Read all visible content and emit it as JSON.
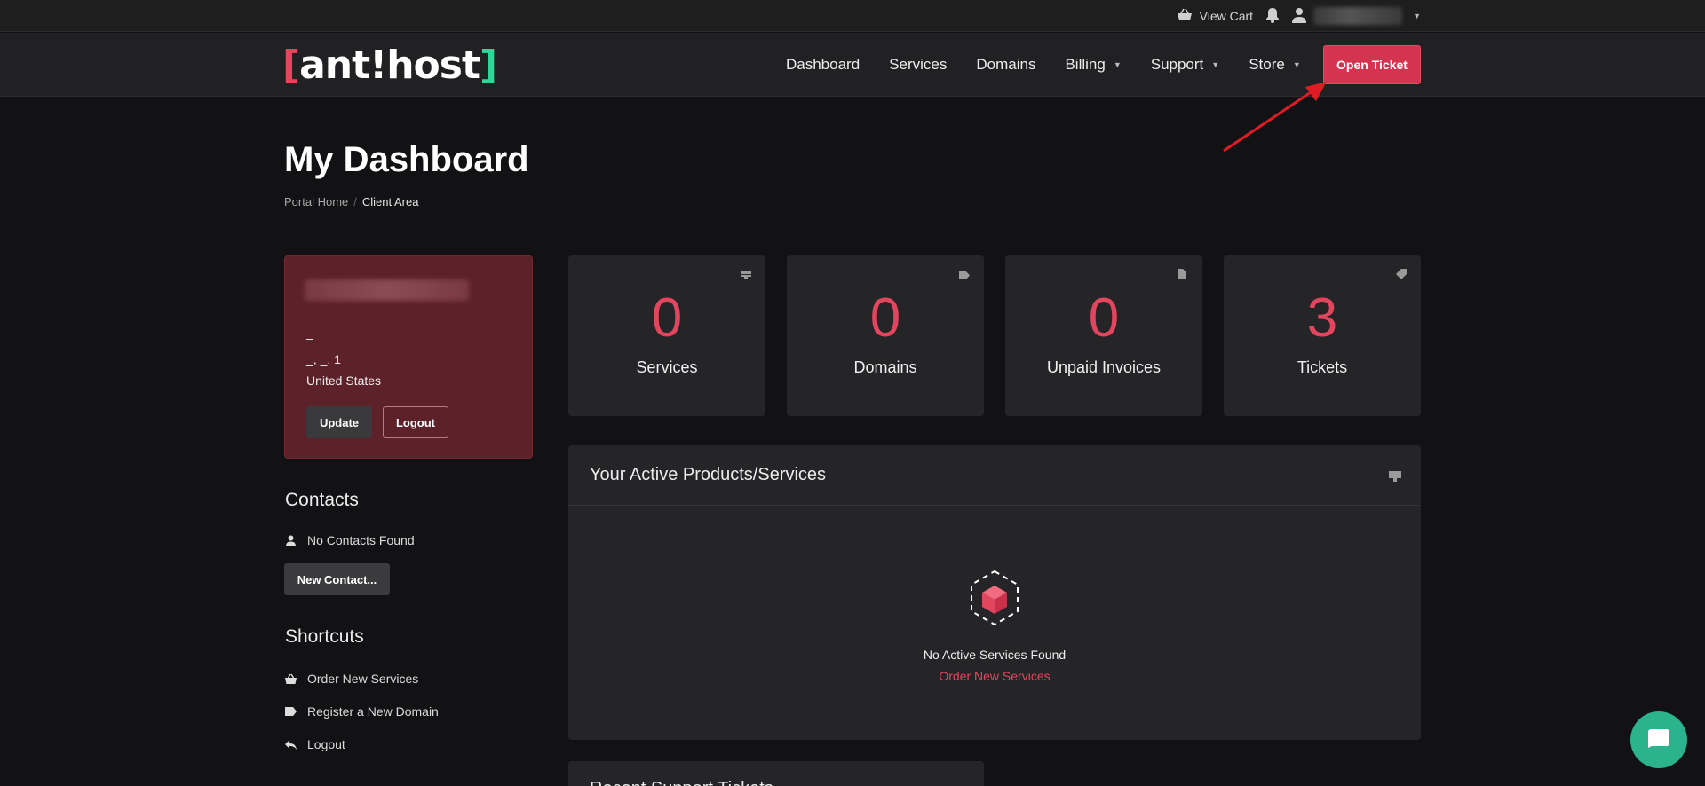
{
  "topbar": {
    "cart_label": "View Cart",
    "cart_icon": "basket-icon",
    "notification_icon": "bell-icon",
    "user_icon": "user-icon"
  },
  "brand": {
    "logo_left": "[",
    "logo_text": "ant!host",
    "logo_right": "]",
    "accent_color": "#e2465e",
    "secondary_color": "#2fd69a"
  },
  "nav": {
    "items": [
      {
        "label": "Dashboard",
        "dropdown": false
      },
      {
        "label": "Services",
        "dropdown": false
      },
      {
        "label": "Domains",
        "dropdown": false
      },
      {
        "label": "Billing",
        "dropdown": true
      },
      {
        "label": "Support",
        "dropdown": true
      },
      {
        "label": "Store",
        "dropdown": true
      }
    ],
    "cta_label": "Open Ticket"
  },
  "header": {
    "title": "My Dashboard",
    "breadcrumb": [
      {
        "label": "Portal Home"
      },
      {
        "label": "Client Area"
      }
    ]
  },
  "profile": {
    "line1": "–",
    "line2": "_, _, 1",
    "country": "United States",
    "update_label": "Update",
    "logout_label": "Logout"
  },
  "contacts": {
    "heading": "Contacts",
    "empty_label": "No Contacts Found",
    "new_button": "New Contact..."
  },
  "shortcuts": {
    "heading": "Shortcuts",
    "items": [
      {
        "label": "Order New Services",
        "icon": "basket-icon"
      },
      {
        "label": "Register a New Domain",
        "icon": "tag-icon"
      },
      {
        "label": "Logout",
        "icon": "back-arrow-icon"
      }
    ]
  },
  "stats": [
    {
      "value": "0",
      "label": "Services",
      "icon": "server-icon"
    },
    {
      "value": "0",
      "label": "Domains",
      "icon": "tag-icon"
    },
    {
      "value": "0",
      "label": "Unpaid Invoices",
      "icon": "document-icon"
    },
    {
      "value": "3",
      "label": "Tickets",
      "icon": "ticket-icon"
    }
  ],
  "products_panel": {
    "title": "Your Active Products/Services",
    "empty_text": "No Active Services Found",
    "order_link": "Order New Services"
  },
  "tickets_panel": {
    "title": "Recent Support Tickets"
  }
}
